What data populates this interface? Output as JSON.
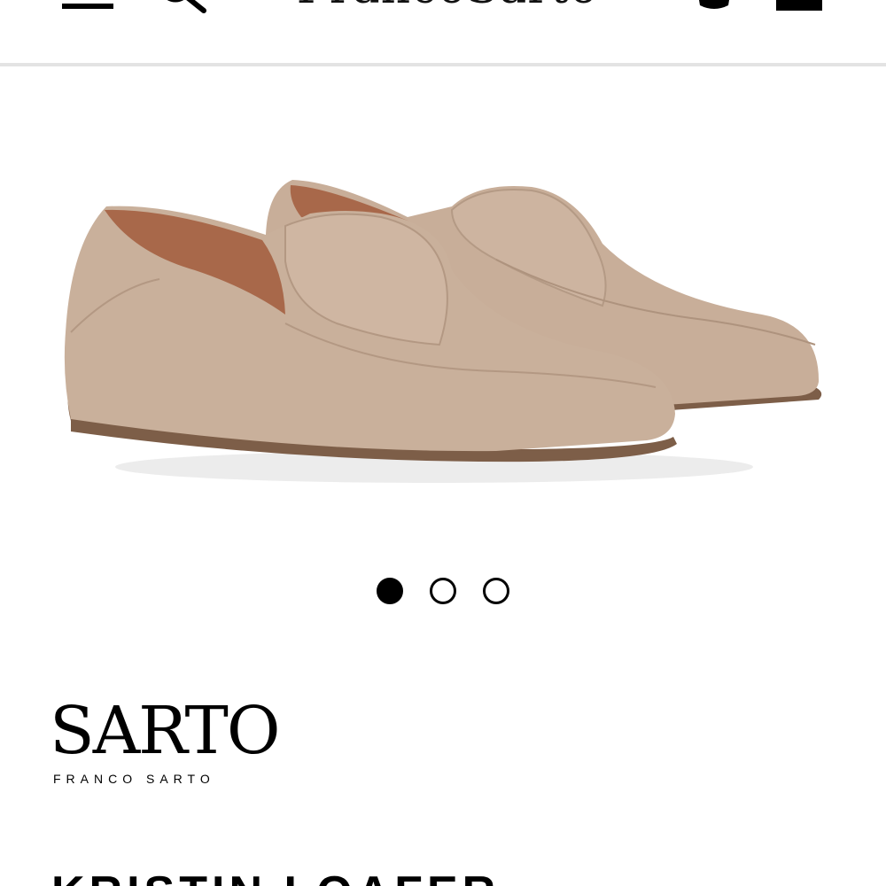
{
  "header": {
    "wordmark": "FrancoSarto",
    "menu_icon": "hamburger-menu-icon",
    "search_icon": "search-icon",
    "account_icon": "account-icon",
    "bag_icon": "shopping-bag-icon"
  },
  "product": {
    "image_alt": "Taupe suede loafers",
    "carousel": {
      "total": 3,
      "active_index": 0
    },
    "brand": {
      "main": "SARTO",
      "sub": "FRANCO SARTO"
    },
    "title": "KRISTIN LOAFER"
  },
  "colors": {
    "suede": "#c9b09b",
    "lining": "#a8684a",
    "sole": "#7d5e48",
    "divider": "#e3e3e3",
    "text": "#000000"
  }
}
